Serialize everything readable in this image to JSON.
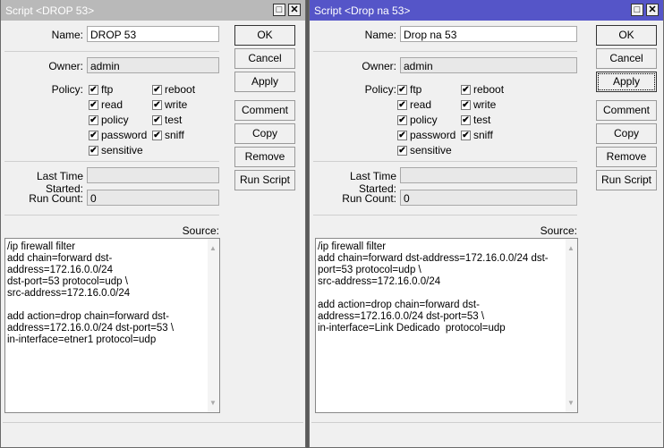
{
  "windows": [
    {
      "title": "Script <DROP 53>",
      "name": "DROP 53",
      "owner": "admin",
      "last_time_started": "",
      "run_count": "0",
      "source": "/ip firewall filter\nadd chain=forward dst-address=172.16.0.0/24\ndst-port=53 protocol=udp \\\nsrc-address=172.16.0.0/24\n\nadd action=drop chain=forward dst-\naddress=172.16.0.0/24 dst-port=53 \\\nin-interface=etner1 protocol=udp"
    },
    {
      "title": "Script <Drop na 53>",
      "name": "Drop na 53",
      "owner": "admin",
      "last_time_started": "",
      "run_count": "0",
      "source": "/ip firewall filter\nadd chain=forward dst-address=172.16.0.0/24 dst-\nport=53 protocol=udp \\\nsrc-address=172.16.0.0/24\n\nadd action=drop chain=forward dst-\naddress=172.16.0.0/24 dst-port=53 \\\nin-interface=Link Dedicado  protocol=udp"
    }
  ],
  "labels": {
    "name": "Name:",
    "owner": "Owner:",
    "policy": "Policy:",
    "last_time_started": "Last Time Started:",
    "run_count": "Run Count:",
    "source": "Source:"
  },
  "policies": [
    "ftp",
    "reboot",
    "read",
    "write",
    "policy",
    "test",
    "password",
    "sniff",
    "sensitive"
  ],
  "check": "✔",
  "buttons": {
    "ok": "OK",
    "cancel": "Cancel",
    "apply": "Apply",
    "comment": "Comment",
    "copy": "Copy",
    "remove": "Remove",
    "run_script": "Run Script"
  },
  "icons": {
    "maximize": "□",
    "close": "✕",
    "up": "▲",
    "down": "▼"
  }
}
